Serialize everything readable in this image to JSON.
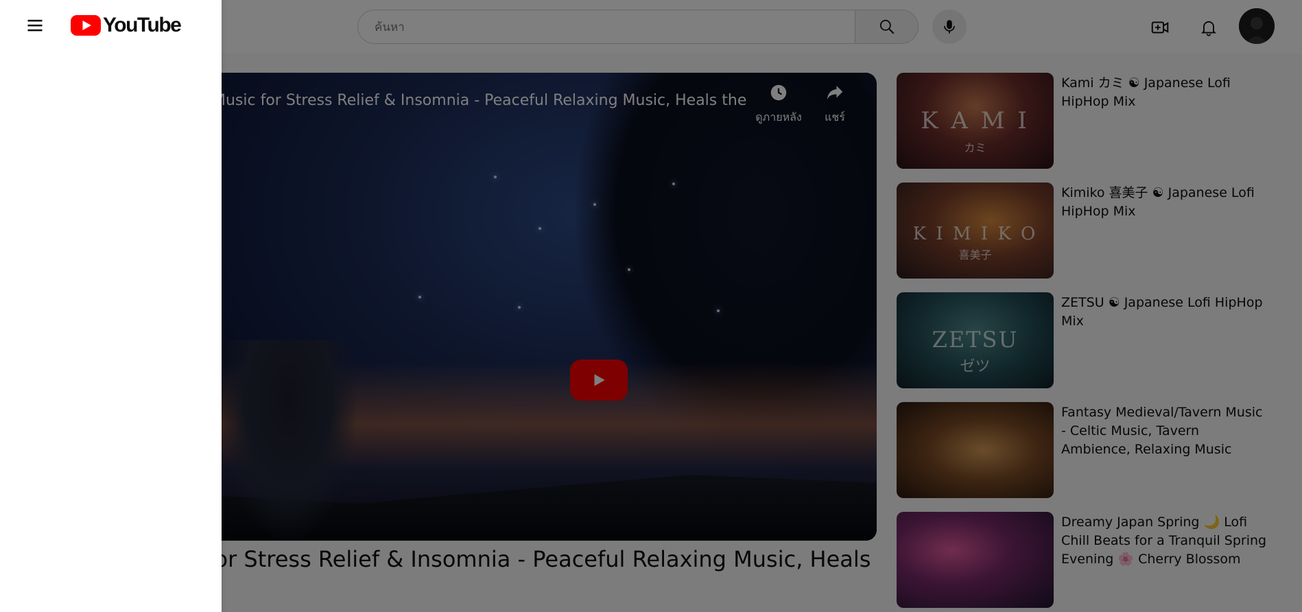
{
  "search": {
    "placeholder": "ค้นหา"
  },
  "player": {
    "title": "Music for Stress Relief & Insomnia - Peaceful Relaxing Music, Heals the Mind...",
    "watch_later_label": "ดูภายหลัง",
    "share_label": "แชร์"
  },
  "video": {
    "title": "Music for Stress Relief & Insomnia - Peaceful Relaxing Music, Heals"
  },
  "recommendations": [
    {
      "title": "Kami カミ ☯ Japanese Lofi HipHop Mix",
      "thumb_text": "K A M I",
      "thumb_subtext": "カミ"
    },
    {
      "title": "Kimiko 喜美子 ☯ Japanese Lofi HipHop Mix",
      "thumb_text": "K I M I K O",
      "thumb_subtext": "喜美子"
    },
    {
      "title": "ZETSU ☯ Japanese Lofi HipHop Mix",
      "thumb_text": "ZETSU",
      "thumb_subtext": "ゼツ"
    },
    {
      "title": "Fantasy Medieval/Tavern Music - Celtic Music, Tavern Ambience, Relaxing Music",
      "thumb_text": "",
      "thumb_subtext": ""
    },
    {
      "title": "Dreamy Japan Spring 🌙 Lofi Chill Beats for a Tranquil Spring Evening 🌸 Cherry Blossom",
      "thumb_text": "",
      "thumb_subtext": ""
    }
  ],
  "logo": {
    "text": "YouTube"
  },
  "colors": {
    "brand": "#ff0000",
    "scrim": "rgba(0,0,0,0.5)"
  }
}
